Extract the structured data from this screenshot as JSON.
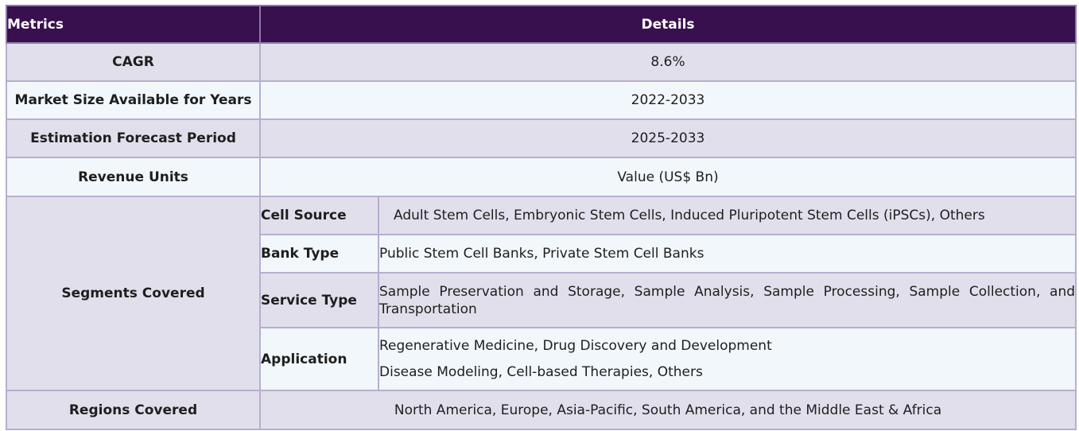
{
  "header": {
    "metrics_label": "Metrics",
    "details_label": "Details"
  },
  "rows": {
    "cagr": {
      "label": "CAGR",
      "value": "8.6%"
    },
    "market_size": {
      "label": "Market Size Available for Years",
      "value": "2022-2033"
    },
    "forecast": {
      "label": "Estimation Forecast Period",
      "value": "2025-2033"
    },
    "revenue_units": {
      "label": "Revenue Units",
      "value": "Value (US$ Bn)"
    },
    "segments": {
      "label": "Segments Covered",
      "cell_source": {
        "label": "Cell Source",
        "value": "Adult Stem Cells, Embryonic Stem Cells, Induced Pluripotent Stem Cells (iPSCs), Others"
      },
      "bank_type": {
        "label": "Bank Type",
        "value": "Public Stem Cell Banks, Private Stem Cell Banks"
      },
      "service_type": {
        "label": "Service Type",
        "value": "Sample Preservation and Storage, Sample Analysis, Sample Processing, Sample Collection, and Transportation"
      },
      "application": {
        "label": "Application",
        "line1": "Regenerative Medicine, Drug Discovery and Development",
        "line2": "Disease Modeling, Cell-based Therapies, Others"
      }
    },
    "regions": {
      "label": "Regions Covered",
      "value": "North America, Europe, Asia-Pacific, South America, and the Middle East & Africa"
    }
  },
  "colors": {
    "header_bg": "#38104e",
    "row_shade": "#e2dfec",
    "row_light": "#f2f7fb",
    "border": "#b6afcf"
  }
}
